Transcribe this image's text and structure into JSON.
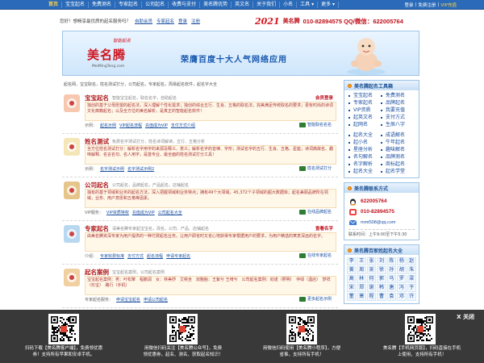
{
  "topnav": {
    "items": [
      "首页",
      "宝宝起名",
      "免费测名",
      "专家起名",
      "公司起名",
      "收费与支付",
      "美名腾优势",
      "英文名",
      "关于我们",
      "小名",
      "工具 ▾",
      "更多 ▾"
    ],
    "right": [
      "登录",
      "免费注册",
      "VIP充值"
    ]
  },
  "welcome": {
    "text": "您好！想畅享最优质的起名服务吗？",
    "links": [
      "自助会员",
      "专家起名",
      "登录",
      "注册"
    ]
  },
  "brandline": {
    "logo_year": "2021",
    "brand": "美名腾",
    "phone": "010-82894575  QQ/微信：622005764"
  },
  "banner": {
    "logo": "美名腾",
    "logo_sub": "智能起名",
    "logo_url": "MeiMingTeng.com",
    "slogan": "荣膺百度十大人气网络应用"
  },
  "breadcrumb": "起名网，宝宝取名，姓名测试打分，公司起名，专家起名，周易起名软件，起名字大全",
  "services": [
    {
      "title": "宝宝起名",
      "sub": "智能宝宝起名，取名名字，自助起名",
      "tag": "会员登录",
      "desc": "独创的基于父母愿望的起名法，深入理解个性化需求；独创的综合五行、生肖、五格的取名法，完美满足传统取名的要求；更有时尚的诗词文化典籍起名；以及全方位的美名解析，是真正的智能起名软件！",
      "link_label": "示例：",
      "links": [
        "起名示例",
        "VIP起名流程",
        "充值成为VIP",
        "支付方式介绍"
      ],
      "go": "智能取名名名",
      "color": "#f7c8b0"
    },
    {
      "title": "姓名测试",
      "sub": "免费名字测试打分，姓名诗词解读，五行、五格分析",
      "tag": "",
      "desc": "全方位姓名测试打分：解析名字用字的来源及释义、意义；解析名字的音律、字形；测试名字的五行、生肖、五格、星座；诗词典故名、趣味解释、名言名句、名人用字，是首专业、最全面的姓名测试打分工具！",
      "link_label": "示例：",
      "links": [
        "名字测试示例",
        "名字测试示例2"
      ],
      "go": "姓名测试打分",
      "color": "#f5e6b8"
    },
    {
      "title": "公司起名",
      "sub": "公司起名，品牌起名，产品起名，店铺起名",
      "tag": "",
      "desc": "独有的基于领域和业务的起名方法，深入把握领域和业务特点；拥有49个大领域，45,372个子领域的超大数据库；起名兼顾品牌所在领域，业务、用户意愿和五格等因素。",
      "link_label": "VIP服务：",
      "links": [
        "VIP资质特权",
        "充值成为VIP",
        "公司起名大全"
      ],
      "go": "在线品牌起名",
      "color": "#e6c58a"
    },
    {
      "title": "专家起名",
      "sub": "请美名腾专家起宝宝名，改名，公司、产品、店铺起名",
      "tag": "查看名字",
      "desc": "由美名腾资深专家为用户提供的一种付费起名业务。让用户即省时又省心地获得专家根据用户的要求，为用户精选的寓意深远的名字。",
      "link_label": "介绍：",
      "links": [
        "专家收费标准",
        "支付方式",
        "起名流程",
        "申请专家起名"
      ],
      "go": "在线专家起名",
      "color": "#b8d8f0"
    },
    {
      "title": "起名案例",
      "sub": "宝宝起名案例，公司起名案例",
      "tag": "",
      "desc": "宝宝起名案例：男：叶松擎　程鹏润　女：林美妤　艾奕含　双胞胎：王紫兮 王绮兮　公司起名案例：劲诺（照明）　伴绿（酒店）　梦祥（珍宝）　路行（手机）",
      "link_label": "专家起名服务：",
      "links": [
        "申请宝宝起名",
        "申请公司起名"
      ],
      "go": "更多起名示例",
      "color": "#f0d0a0"
    }
  ],
  "sidebar": {
    "tools_title": "美名腾起名工具箱",
    "tools": [
      "宝宝起名",
      "免费测名",
      "专家起名",
      "品牌起名",
      "VIP资质",
      "我要充值",
      "起英文名",
      "支付方式",
      "起网名",
      "生辰八字",
      "起名大全",
      "成语解名",
      "起小名",
      "牛年起名",
      "星座分析",
      "趣味解名",
      "名句解名",
      "品牌测名",
      "名字解析",
      "商标起名",
      "起名大全",
      "起名学堂"
    ],
    "contact_title": "美名腾联系方式",
    "qq": "622005764",
    "phone": "010-82894575",
    "email": "mmt508@qq.com",
    "time": "联系时间：上午9:00至下午5:30",
    "surname_title": "美名腾百家姓起名大全",
    "surnames": [
      "李",
      "王",
      "张",
      "刘",
      "陈",
      "杨",
      "赵",
      "黄",
      "周",
      "吴",
      "徐",
      "孙",
      "胡",
      "朱",
      "高",
      "林",
      "何",
      "郭",
      "马",
      "罗",
      "梁",
      "宋",
      "郑",
      "谢",
      "韩",
      "唐",
      "冯",
      "于",
      "董",
      "萧",
      "程",
      "曹",
      "袁",
      "邓",
      "许"
    ]
  },
  "overlay": {
    "close": "X 关闭",
    "items": [
      {
        "line1": "扫码下载【美名腾客户端】，免费领优惠",
        "line2": "券！支持所有苹果和安卓手机。"
      },
      {
        "line1": "用微信扫码关注【美名腾公众号】，免费",
        "line2": "领优惠券，起名、测名、获取起名知识！"
      },
      {
        "line1": "用微信扫码使用【美名腾小程序】，方便",
        "line2": "省事，支持所有手机！"
      },
      {
        "line1": "美名腾【手机网页版】，扫码直接在手机",
        "line2": "上使用，支持所有手机！"
      }
    ]
  }
}
